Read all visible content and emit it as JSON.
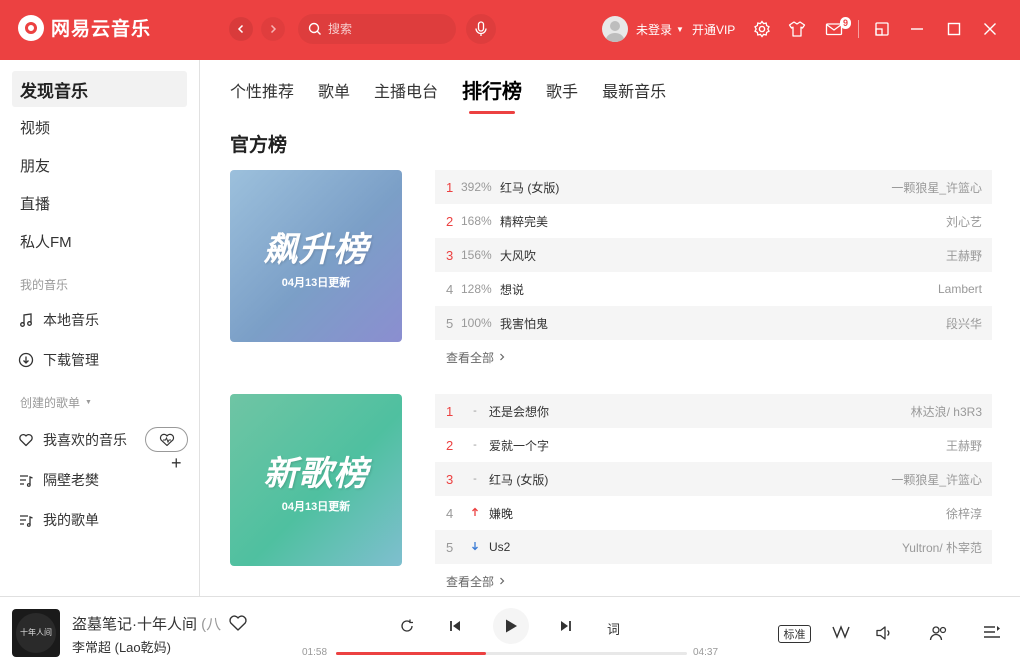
{
  "app": {
    "name": "网易云音乐",
    "brand_color": "#ec4141"
  },
  "header": {
    "search_placeholder": "搜索",
    "user_name": "未登录",
    "vip_label": "开通VIP",
    "mail_count": "9"
  },
  "sidebar": {
    "main_items": [
      {
        "label": "发现音乐",
        "active": true
      },
      {
        "label": "视频"
      },
      {
        "label": "朋友"
      },
      {
        "label": "直播"
      },
      {
        "label": "私人FM"
      }
    ],
    "my_music_title": "我的音乐",
    "my_music": [
      {
        "label": "本地音乐",
        "icon": "music-note-icon"
      },
      {
        "label": "下载管理",
        "icon": "download-icon"
      }
    ],
    "created_title": "创建的歌单",
    "created": [
      {
        "label": "我喜欢的音乐",
        "icon": "heart-icon"
      },
      {
        "label": "隔壁老樊",
        "icon": "playlist-icon"
      },
      {
        "label": "我的歌单",
        "icon": "playlist-icon"
      }
    ]
  },
  "main": {
    "tabs": [
      {
        "label": "个性推荐"
      },
      {
        "label": "歌单"
      },
      {
        "label": "主播电台"
      },
      {
        "label": "排行榜",
        "active": true
      },
      {
        "label": "歌手"
      },
      {
        "label": "最新音乐"
      }
    ],
    "section_title": "官方榜",
    "charts": [
      {
        "cover_name": "飙升榜",
        "cover_date": "04月13日更新",
        "cover_color": "#7b9fc7",
        "rows": [
          {
            "rank": "1",
            "pct": "392%",
            "song": "红马 (女版)",
            "artist": "一颗狼星_许篮心"
          },
          {
            "rank": "2",
            "pct": "168%",
            "song": "精粹完美",
            "artist": "刘心艺"
          },
          {
            "rank": "3",
            "pct": "156%",
            "song": "大风吹",
            "artist": "王赫野"
          },
          {
            "rank": "4",
            "pct": "128%",
            "song": "想说",
            "artist": "Lambert"
          },
          {
            "rank": "5",
            "pct": "100%",
            "song": "我害怕鬼",
            "artist": "段兴华"
          }
        ],
        "see_all": "查看全部"
      },
      {
        "cover_name": "新歌榜",
        "cover_date": "04月13日更新",
        "cover_color": "#4fc0a0",
        "rows": [
          {
            "rank": "1",
            "trend": "-",
            "song": "还是会想你",
            "artist": "林达浪/ h3R3"
          },
          {
            "rank": "2",
            "trend": "-",
            "song": "爱就一个字",
            "artist": "王赫野"
          },
          {
            "rank": "3",
            "trend": "-",
            "song": "红马 (女版)",
            "artist": "一颗狼星_许篮心"
          },
          {
            "rank": "4",
            "trend": "up",
            "song": "嫌晚",
            "artist": "徐梓淳"
          },
          {
            "rank": "5",
            "trend": "down",
            "song": "Us2",
            "artist": "Yultron/ 朴宰范"
          }
        ],
        "see_all": "查看全部"
      }
    ]
  },
  "player": {
    "title": "盗墓笔记·十年人间",
    "title_overflow": "(八",
    "artist": "李常超 (Lao乾妈)",
    "cover_text": "十年人间",
    "current_time": "01:58",
    "total_time": "04:37",
    "progress": 0.426,
    "lyric_label": "词",
    "quality_label": "标准"
  }
}
